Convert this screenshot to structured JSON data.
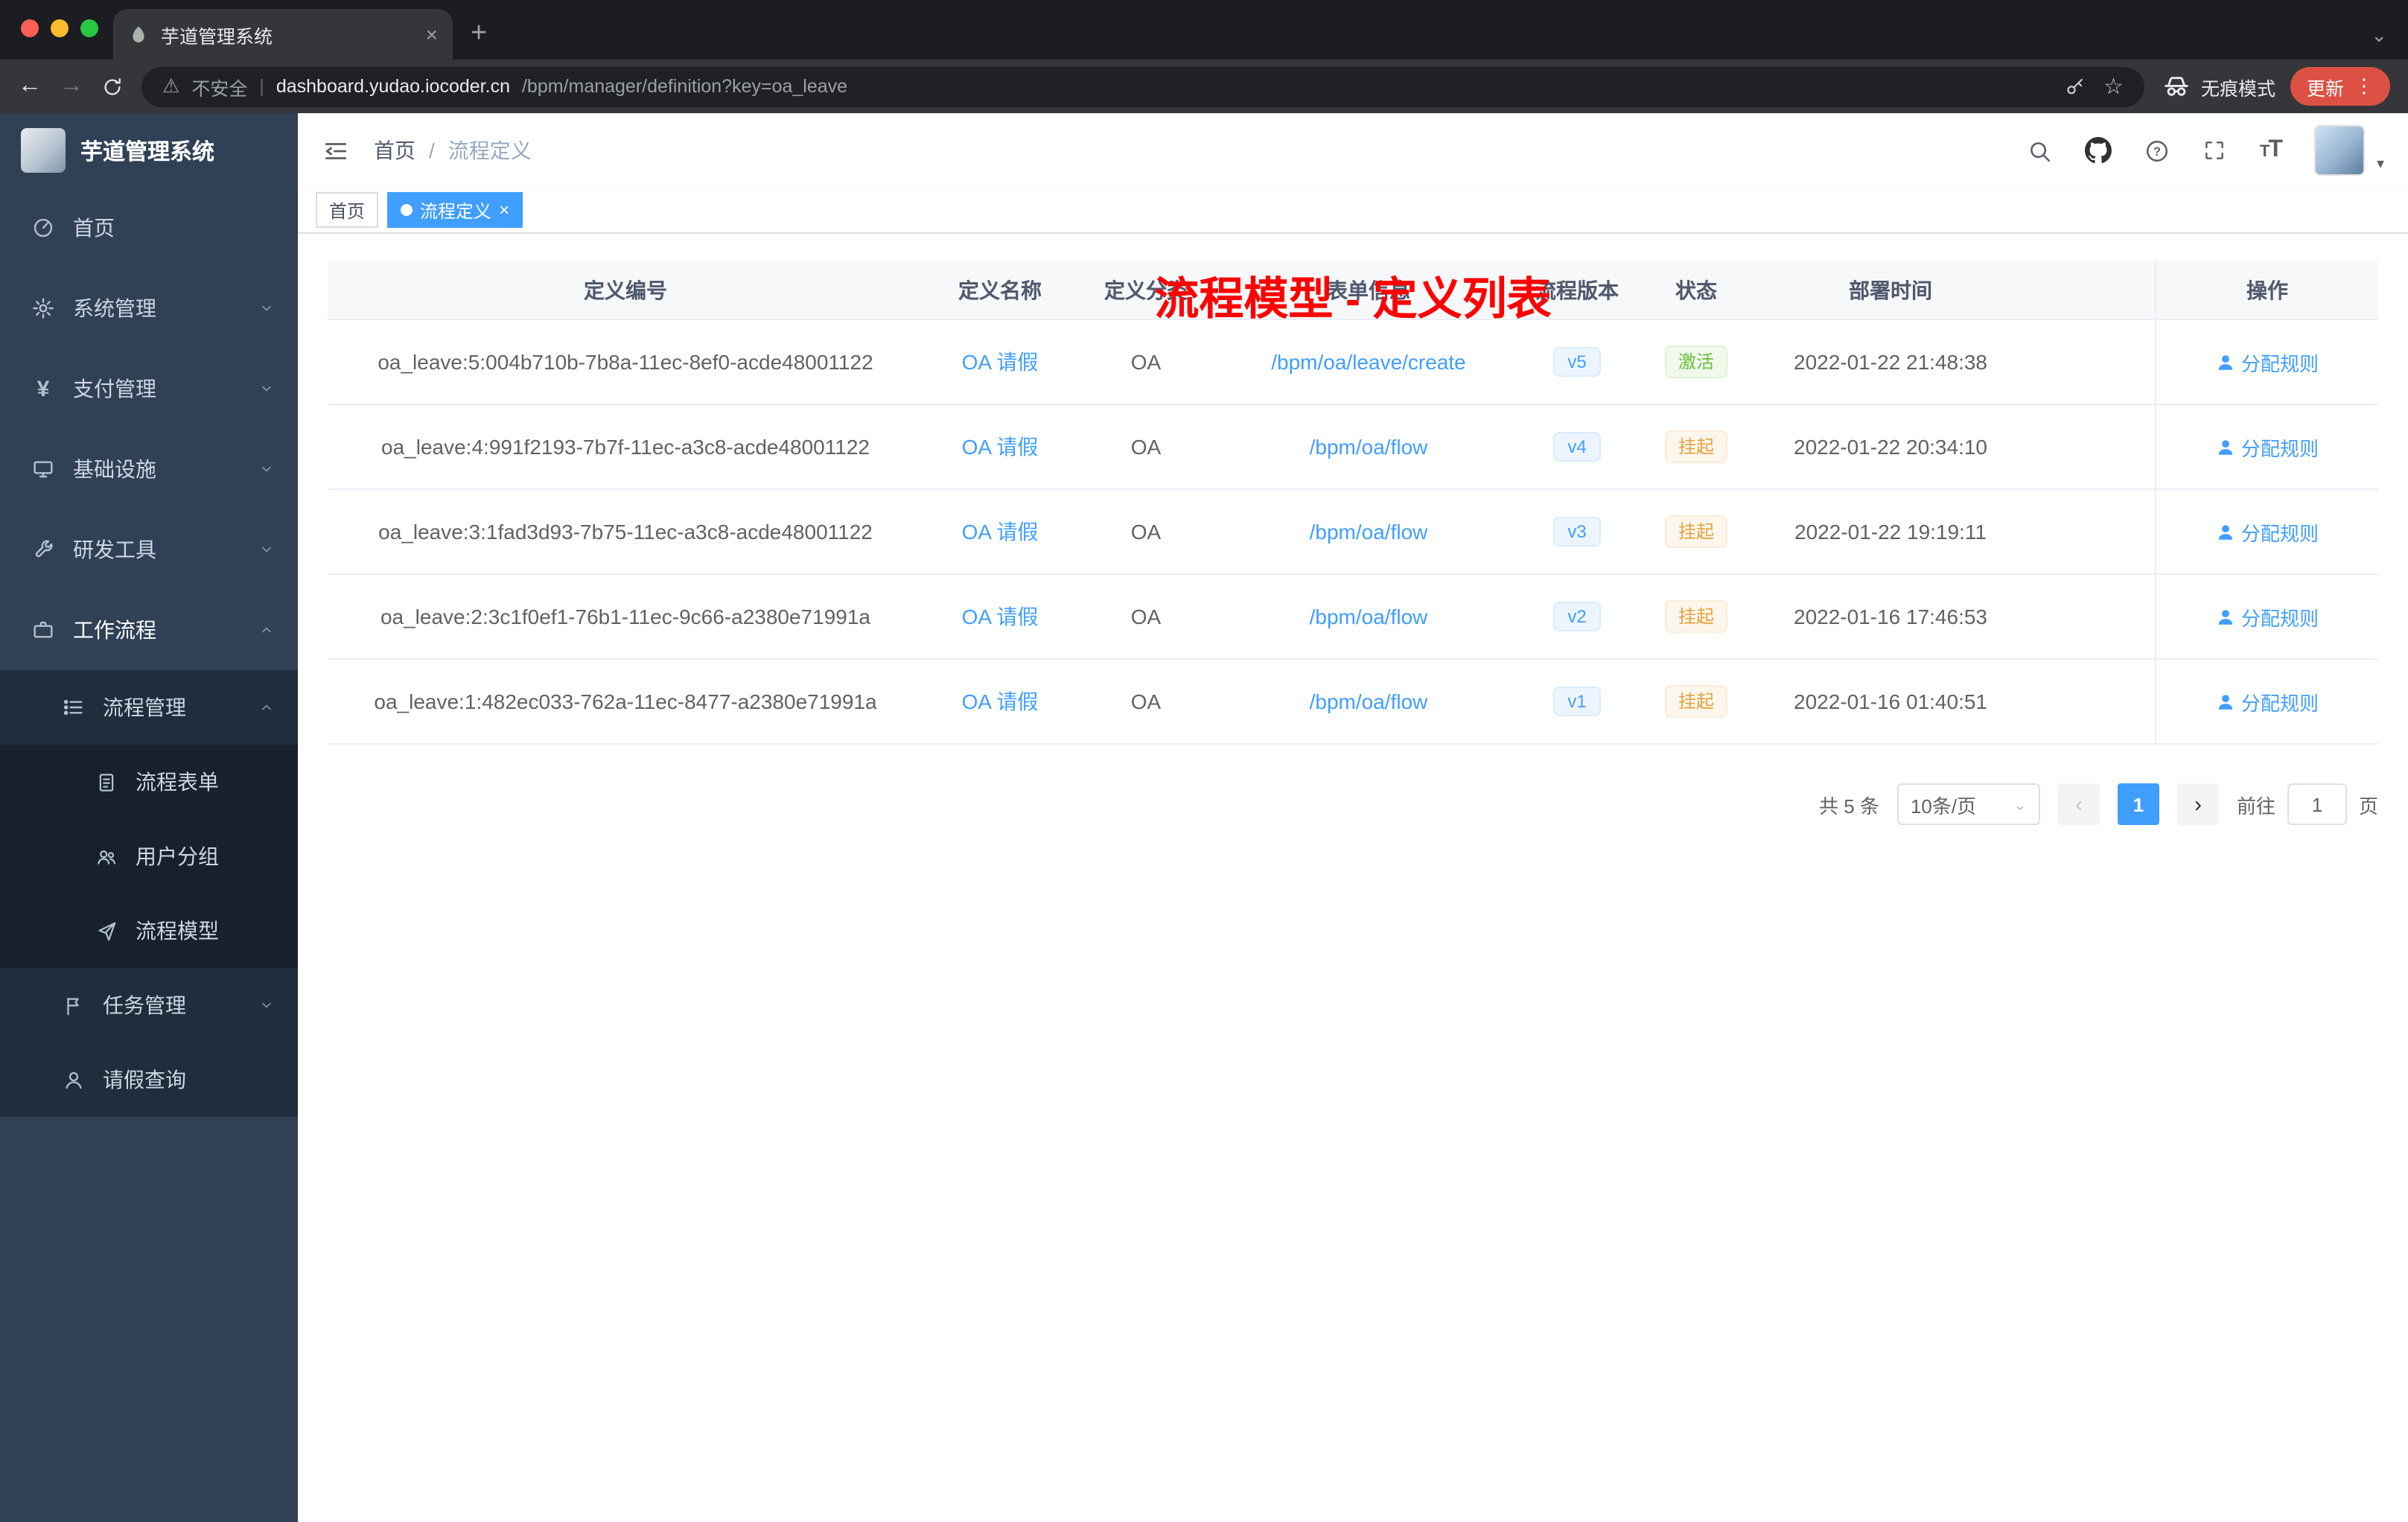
{
  "browser": {
    "tab_title": "芋道管理系统",
    "url": {
      "security_text": "不安全",
      "host": "dashboard.yudao.iocoder.cn",
      "path": "/bpm/manager/definition?key=oa_leave"
    },
    "incognito_label": "无痕模式",
    "update_label": "更新"
  },
  "glyphs": {
    "close": "×",
    "plus": "+",
    "chevron_down": "⌄",
    "back": "←",
    "forward": "→",
    "warning": "⚠",
    "divider": "|",
    "star": "☆",
    "dots": "⋮",
    "yen": "¥",
    "slash": "/",
    "caret_down": "▾",
    "prev": "‹",
    "next": "›",
    "question": "?",
    "font_small": "T",
    "font_big": "T"
  },
  "sidebar": {
    "logo_title": "芋道管理系统",
    "items": [
      {
        "label": "首页"
      },
      {
        "label": "系统管理"
      },
      {
        "label": "支付管理"
      },
      {
        "label": "基础设施"
      },
      {
        "label": "研发工具"
      },
      {
        "label": "工作流程"
      },
      {
        "label": "流程管理"
      },
      {
        "label": "流程表单"
      },
      {
        "label": "用户分组"
      },
      {
        "label": "流程模型"
      },
      {
        "label": "任务管理"
      },
      {
        "label": "请假查询"
      }
    ]
  },
  "header": {
    "breadcrumb": {
      "home": "首页",
      "separator": "/",
      "current": "流程定义"
    },
    "annotation": "流程模型 - 定义列表"
  },
  "tags": [
    {
      "label": "首页"
    },
    {
      "label": "流程定义"
    }
  ],
  "table": {
    "columns": [
      "定义编号",
      "定义名称",
      "定义分类",
      "表单信息",
      "流程版本",
      "状态",
      "部署时间",
      "操作"
    ],
    "rows": [
      {
        "id": "oa_leave:5:004b710b-7b8a-11ec-8ef0-acde48001122",
        "name": "OA 请假",
        "category": "OA",
        "form": "/bpm/oa/leave/create",
        "version": "v5",
        "status": "激活",
        "status_type": "success",
        "time": "2022-01-22 21:48:38",
        "action": "分配规则"
      },
      {
        "id": "oa_leave:4:991f2193-7b7f-11ec-a3c8-acde48001122",
        "name": "OA 请假",
        "category": "OA",
        "form": "/bpm/oa/flow",
        "version": "v4",
        "status": "挂起",
        "status_type": "warning",
        "time": "2022-01-22 20:34:10",
        "action": "分配规则"
      },
      {
        "id": "oa_leave:3:1fad3d93-7b75-11ec-a3c8-acde48001122",
        "name": "OA 请假",
        "category": "OA",
        "form": "/bpm/oa/flow",
        "version": "v3",
        "status": "挂起",
        "status_type": "warning",
        "time": "2022-01-22 19:19:11",
        "action": "分配规则"
      },
      {
        "id": "oa_leave:2:3c1f0ef1-76b1-11ec-9c66-a2380e71991a",
        "name": "OA 请假",
        "category": "OA",
        "form": "/bpm/oa/flow",
        "version": "v2",
        "status": "挂起",
        "status_type": "warning",
        "time": "2022-01-16 17:46:53",
        "action": "分配规则"
      },
      {
        "id": "oa_leave:1:482ec033-762a-11ec-8477-a2380e71991a",
        "name": "OA 请假",
        "category": "OA",
        "form": "/bpm/oa/flow",
        "version": "v1",
        "status": "挂起",
        "status_type": "warning",
        "time": "2022-01-16 01:40:51",
        "action": "分配规则"
      }
    ]
  },
  "pagination": {
    "total": "共 5 条",
    "page_size": "10条/页",
    "current_page": "1",
    "goto_label": "前往",
    "goto_value": "1",
    "unit": "页"
  },
  "colors": {
    "accent": "#409eff",
    "success": "#67c23a",
    "warning": "#e6a23c",
    "annotation_red": "#ff0000",
    "sidebar_bg": "#304156",
    "update_chip": "#dd5144"
  }
}
